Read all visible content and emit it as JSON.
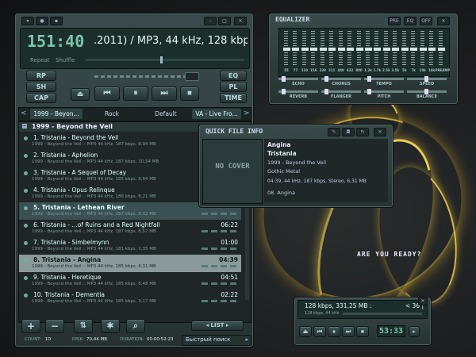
{
  "player": {
    "time": "151:40",
    "track_info": ".2011) / MP3, 44 kHz, 128 kbp",
    "repeat_label": "Repeat",
    "shuffle_label": "Shuffle",
    "left_buttons": [
      "RP",
      "SH",
      "CAP"
    ],
    "right_buttons": [
      "EQ",
      "PL",
      "TIME"
    ],
    "controls": {
      "eject": "⏏",
      "prev": "⏮",
      "pause": "⏸",
      "next": "⏭",
      "stop": "⏹"
    }
  },
  "tabs": [
    "1999 - Beyon...",
    "Rock",
    "Default",
    "VA - Live Fro..."
  ],
  "playlist": {
    "group": "1999 - Beyond the Veil",
    "tracks": [
      {
        "title": "1. Tristania - Beyond the Veil",
        "sub": "1999 - Beyond the Veil :: MP3 44 kHz, 187 kbps, 8,94 MB",
        "dur": ""
      },
      {
        "title": "2. Tristania - Aphelion",
        "sub": "1999 - Beyond the Veil :: MP3 44 kHz, 187 kbps, 10,54 MB",
        "dur": ""
      },
      {
        "title": "3. Tristania - A Sequel of Decay",
        "sub": "1999 - Beyond the Veil :: MP3 44 kHz, 185 kbps, 8,84 MB",
        "dur": ""
      },
      {
        "title": "4. Tristania - Opus Relinque",
        "sub": "1999 - Beyond the Veil :: MP3 44 kHz, 186 kbps, 8,21 MB",
        "dur": ""
      },
      {
        "title": "5. Tristania - Lethean River",
        "sub": "1999 - Beyond the Veil :: MP3 44 kHz, 187 kbps, 8,02 MB",
        "dur": ""
      },
      {
        "title": "6. Tristania - ...of Ruins and a Red Nightfall",
        "sub": "1999 - Beyond the Veil :: MP3 44 kHz, 187 kbps, 8,57 MB",
        "dur": "06:22"
      },
      {
        "title": "7. Tristania - Simbelmynn",
        "sub": "1999 - Beyond the Veil :: MP3 44 kHz, 181 kbps, 1,35 MB",
        "dur": "01:00"
      },
      {
        "title": "8. Tristania - Angina",
        "sub": "1999 - Beyond the Veil :: MP3 44 kHz, 185 kbps, 6,31 MB",
        "dur": "04:39"
      },
      {
        "title": "9. Tristania - Heretique",
        "sub": "1999 - Beyond the Veil :: MP3 44 kHz, 185 kbps, 6,48 MB",
        "dur": "04:51"
      },
      {
        "title": "10. Tristania - Dementia",
        "sub": "1999 - Beyond the Veil :: MP3 44 kHz, 185 kbps, 3,17 MB",
        "dur": "02:22"
      }
    ],
    "footer": {
      "count_label": "COUNT:",
      "count": "10",
      "disk_label": "DISK:",
      "disk": "70,44 MB",
      "duration_label": "DURATION:",
      "duration": "00:00:52:23",
      "list_button": "LIST",
      "search_label": "Быстрый поиск"
    },
    "bottom_icons": [
      "plus-icon",
      "minus-icon",
      "sort-icon",
      "gear-icon",
      "search-icon"
    ]
  },
  "equalizer": {
    "title": "EQUALIZER",
    "header_buttons": [
      "PRE",
      "EQ",
      "OFF"
    ],
    "bands": [
      0.5,
      0.5,
      0.5,
      0.5,
      0.5,
      0.5,
      0.5,
      0.5,
      0.5,
      0.5,
      0.5,
      0.5,
      0.5,
      0.5,
      0.5,
      0.5,
      0.5,
      0.5
    ],
    "band_labels": [
      "55",
      "77",
      "110",
      "156",
      "220",
      "311",
      "440",
      "622",
      "880",
      "1.2k",
      "1.7k",
      "2.5k",
      "3.5k",
      "5k",
      "7k",
      "10k",
      "14k",
      "PREAMP"
    ],
    "effects_row1": [
      "ECHO",
      "CHORUS",
      "TEMPO",
      "SPEED"
    ],
    "effects_row2": [
      "REVERB",
      "FLANGER",
      "PITCH",
      "BALANCE"
    ]
  },
  "quick_info": {
    "title": "QUICK FILE INFO",
    "cover_text": "NO COVER",
    "track": "Angina",
    "artist": "Tristania",
    "album": "1999 - Beyond the Veil",
    "genre": "Gothic Metal",
    "tech": "04:39, 44 kHz, 187 kbps, Stereo, 6,31 MB",
    "number": "08. Angina"
  },
  "tagline": "ARE YOU READY?",
  "mini": {
    "info": "128 kbps, 331,25 MB :",
    "counter": "< 36 |",
    "sub": "128 kbps, 44 kHz",
    "time": "53:33"
  }
}
